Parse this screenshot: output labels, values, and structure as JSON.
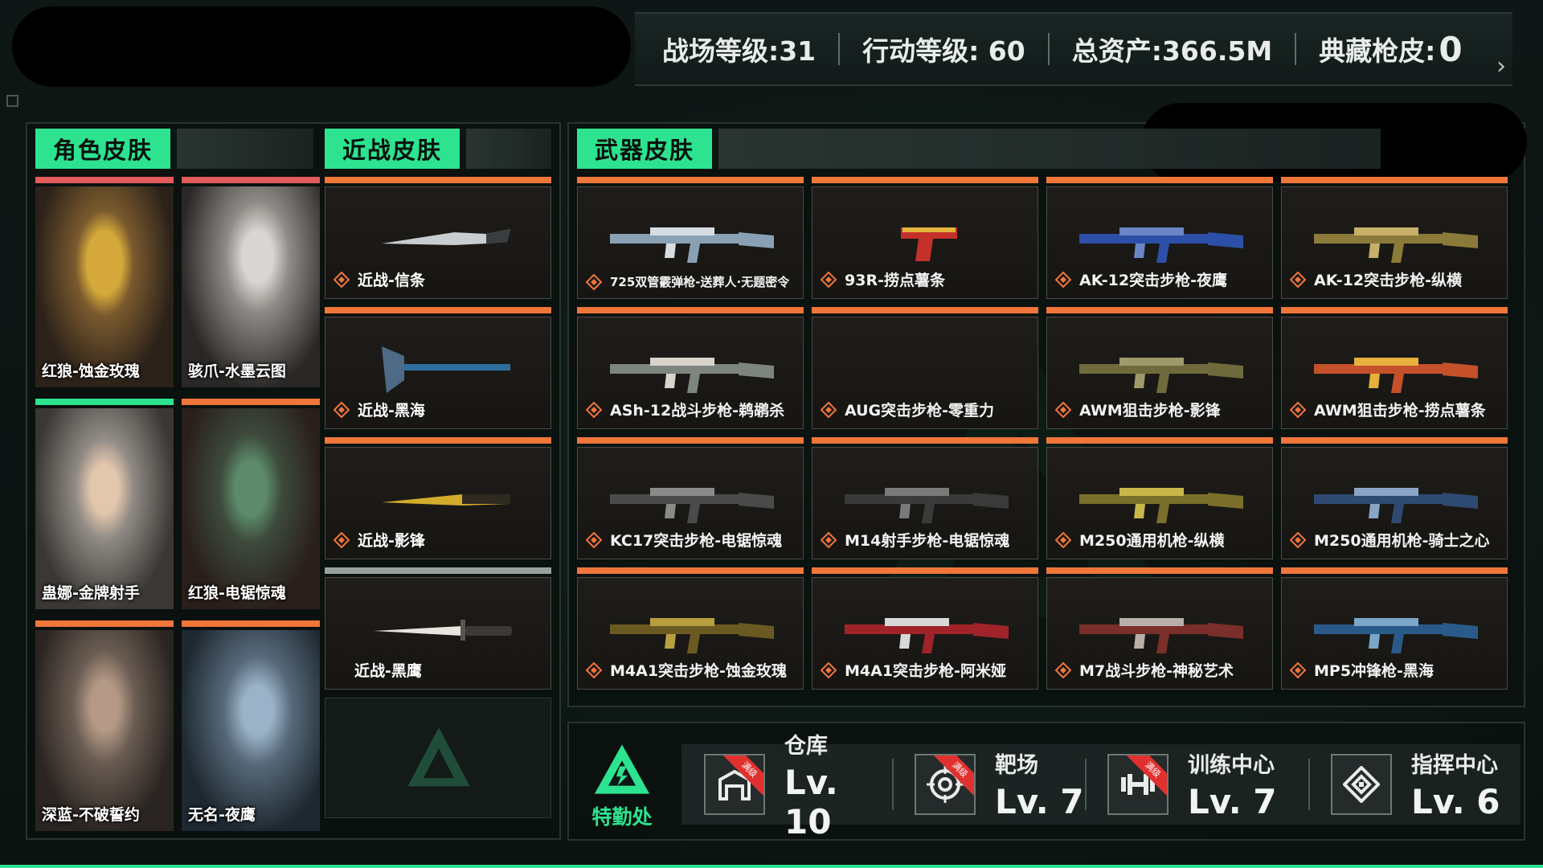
{
  "topbar": {
    "battlefield_level": "战场等级:31",
    "operation_level": "行动等级: 60",
    "total_assets": "总资产:366.5M",
    "collection_label": "典藏枪皮:",
    "collection_value": "0",
    "arrow": "›"
  },
  "sections": {
    "character": "角色皮肤",
    "melee": "近战皮肤",
    "weapon": "武器皮肤"
  },
  "characters": [
    {
      "label": "红狼-蚀金玫瑰",
      "bar_color": "#e25a5a"
    },
    {
      "label": "骇爪-水墨云图",
      "bar_color": "#e25a5a"
    },
    {
      "label": "蛊娜-金牌射手",
      "bar_color": "#2de38f"
    },
    {
      "label": "红狼-电锯惊魂",
      "bar_color": "#f0763a"
    },
    {
      "label": "深蓝-不破誓约",
      "bar_color": "#f0763a"
    },
    {
      "label": "无名-夜鹰",
      "bar_color": "#f0763a"
    }
  ],
  "melee": [
    {
      "label": "近战-信条",
      "bar_color": "#f0763a"
    },
    {
      "label": "近战-黑海",
      "bar_color": "#f0763a"
    },
    {
      "label": "近战-影锋",
      "bar_color": "#f0763a"
    },
    {
      "label": "近战-黑鹰",
      "bar_color": "#9aa09e"
    }
  ],
  "weapons": [
    {
      "label": "725双管霰弹枪-送葬人·无题密令"
    },
    {
      "label": "93R-捞点薯条"
    },
    {
      "label": "AK-12突击步枪-夜鹰"
    },
    {
      "label": "AK-12突击步枪-纵横"
    },
    {
      "label": "ASh-12战斗步枪-鹈鹕杀"
    },
    {
      "label": "AUG突击步枪-零重力"
    },
    {
      "label": "AWM狙击步枪-影锋"
    },
    {
      "label": "AWM狙击步枪-捞点薯条"
    },
    {
      "label": "KC17突击步枪-电锯惊魂"
    },
    {
      "label": "M14射手步枪-电锯惊魂"
    },
    {
      "label": "M250通用机枪-纵横"
    },
    {
      "label": "M250通用机枪-骑士之心"
    },
    {
      "label": "M4A1突击步枪-蚀金玫瑰"
    },
    {
      "label": "M4A1突击步枪-阿米娅"
    },
    {
      "label": "M7战斗步枪-神秘艺术"
    },
    {
      "label": "MP5冲锋枪-黑海"
    }
  ],
  "facility_logo": "特勤处",
  "facilities": [
    {
      "name": "仓库",
      "level": "Lv. 10",
      "badge": "满级",
      "icon": "warehouse-icon"
    },
    {
      "name": "靶场",
      "level": "Lv. 7",
      "badge": "满级",
      "icon": "target-icon"
    },
    {
      "name": "训练中心",
      "level": "Lv. 7",
      "badge": "满级",
      "icon": "dumbbell-icon"
    },
    {
      "name": "指挥中心",
      "level": "Lv. 6",
      "badge": "",
      "icon": "command-icon"
    }
  ],
  "colors": {
    "accent": "#2de38f",
    "orange_bar": "#f0763a",
    "red_bar": "#e25a5a",
    "badge_red": "#e0312f"
  }
}
